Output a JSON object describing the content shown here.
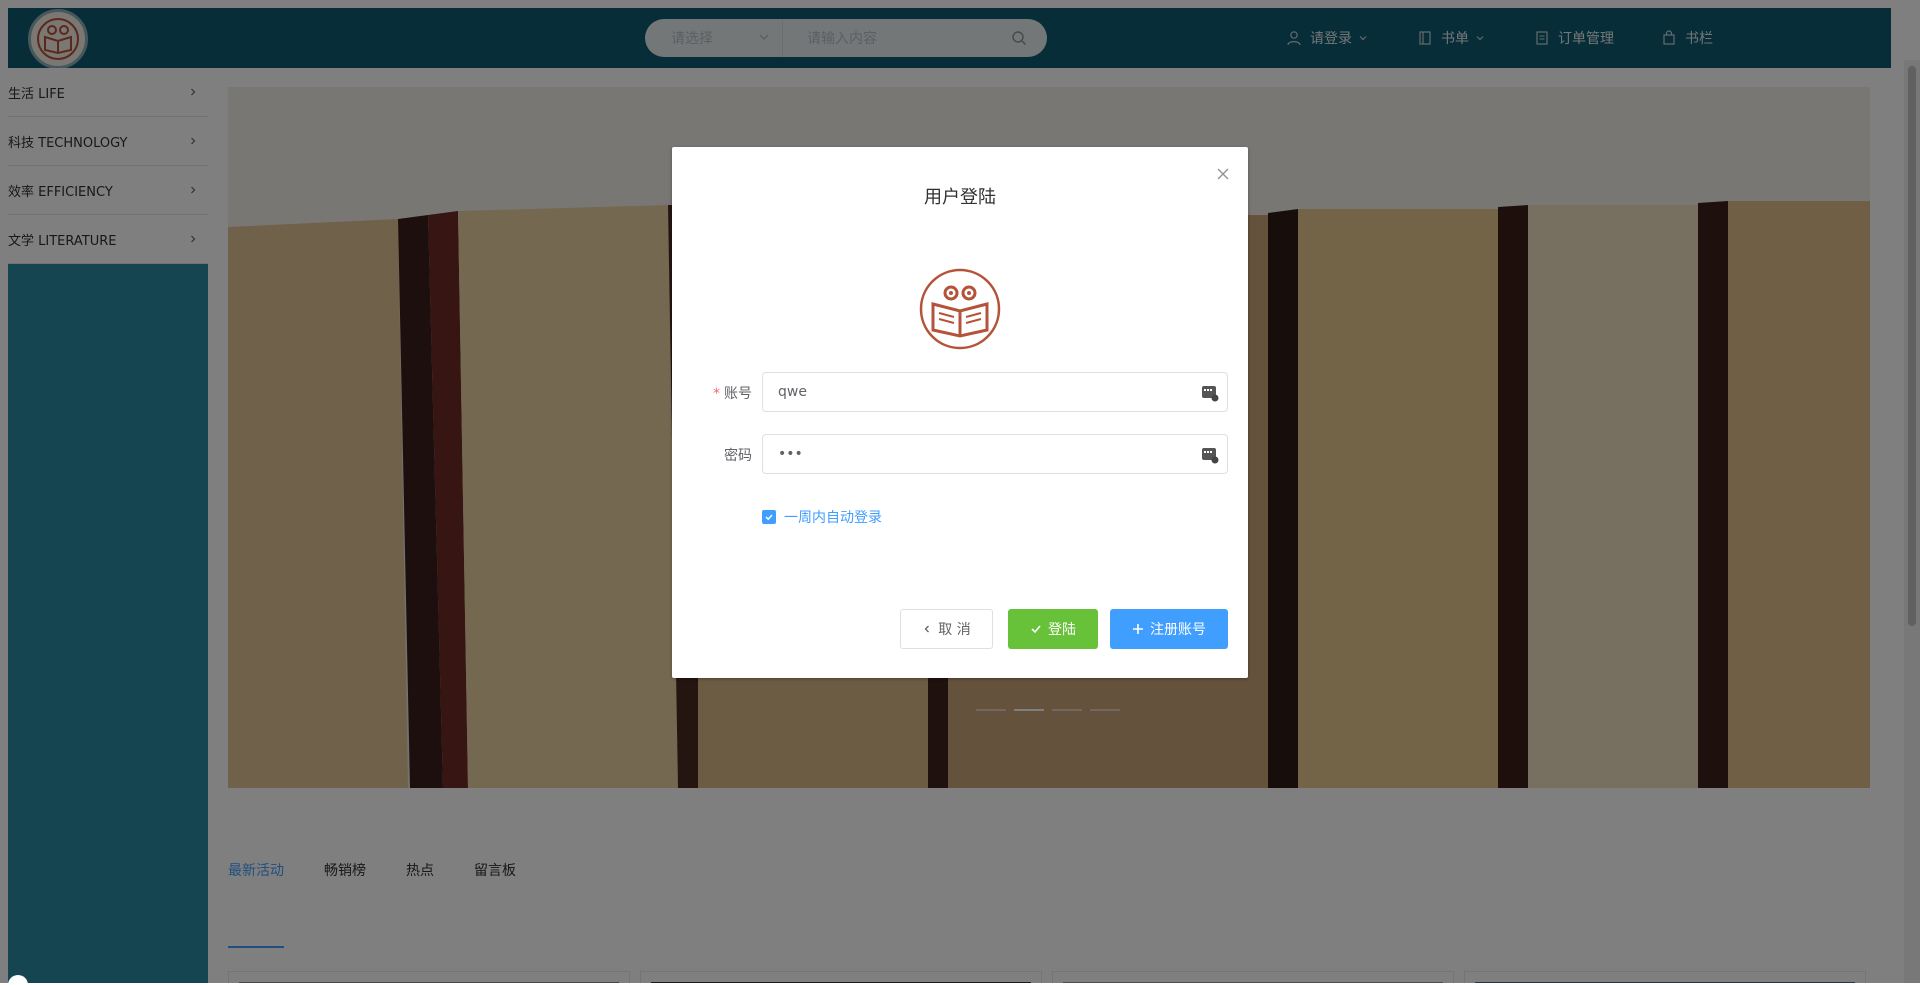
{
  "header": {
    "search_select_placeholder": "请选择",
    "search_input_placeholder": "请输入内容",
    "nav": {
      "login": "请登录",
      "booklist": "书单",
      "orders": "订单管理",
      "shelf": "书栏"
    }
  },
  "sidebar": {
    "items": [
      {
        "label": "生活 LIFE"
      },
      {
        "label": "科技 TECHNOLOGY"
      },
      {
        "label": "效率 EFFICIENCY"
      },
      {
        "label": "文学 LITERATURE"
      }
    ]
  },
  "carousel": {
    "slide_count": 4,
    "active_index": 1
  },
  "tabs": [
    {
      "label": "最新活动",
      "active": true
    },
    {
      "label": "畅销榜",
      "active": false
    },
    {
      "label": "热点",
      "active": false
    },
    {
      "label": "留言板",
      "active": false
    }
  ],
  "dialog": {
    "title": "用户登陆",
    "account_label": "账号",
    "account_value": "qwe",
    "password_label": "密码",
    "password_value": "•••",
    "remember_label": "一周内自动登录",
    "remember_checked": true,
    "cancel_label": "取 消",
    "login_label": "登陆",
    "register_label": "注册账号"
  },
  "colors": {
    "header_bg": "#0e5a70",
    "sidebar_bg": "#2c8ba4",
    "primary": "#409eff",
    "success": "#67c23a",
    "logo_brown": "#b5533a"
  },
  "icons": {
    "user": "user-icon",
    "book": "book-icon",
    "orders": "document-icon",
    "shelf": "bag-icon",
    "search": "search-icon",
    "close": "close-icon"
  }
}
